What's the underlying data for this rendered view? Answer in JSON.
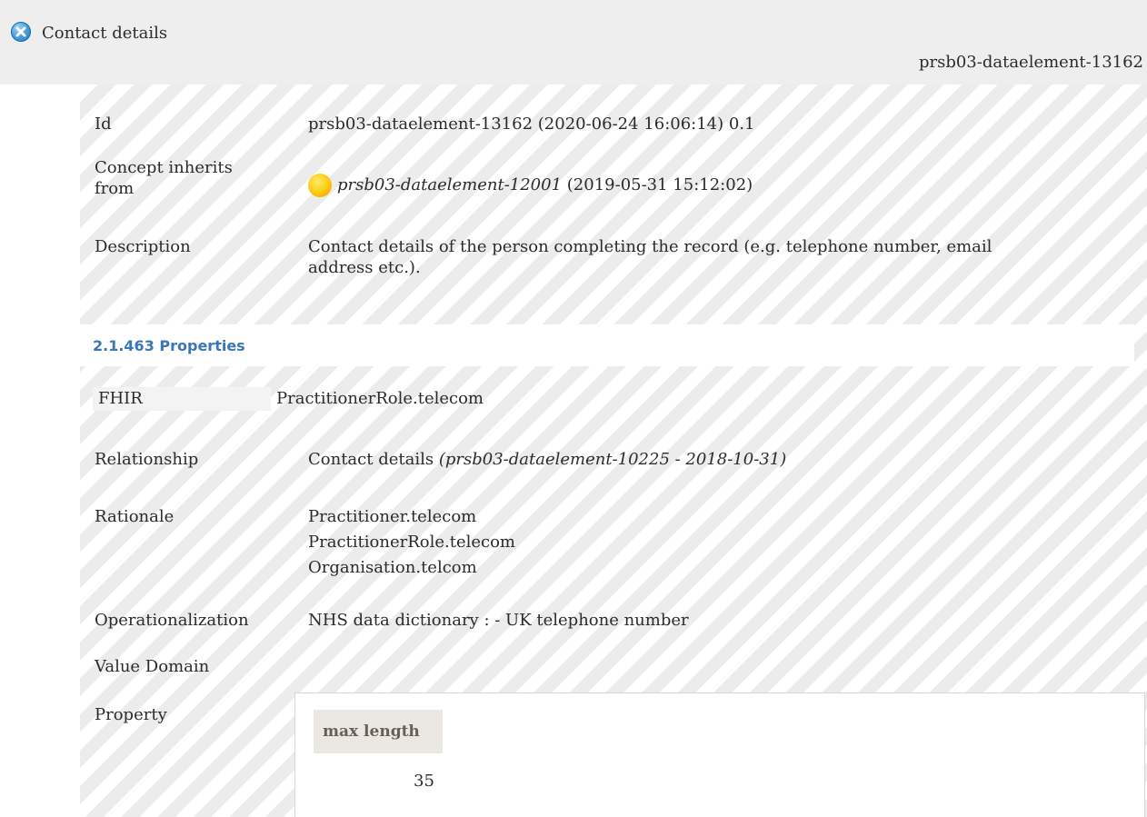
{
  "header": {
    "title": "Contact details",
    "id": "prsb03-dataelement-13162"
  },
  "details": {
    "id_label": "Id",
    "id_value": "prsb03-dataelement-13162 (2020-06-24 16:06:14) 0.1",
    "inherits_label_line1": "Concept inherits",
    "inherits_label_line2": "from",
    "inherits_link": "prsb03-dataelement-12001",
    "inherits_date": "(2019-05-31 15:12:02)",
    "description_label": "Description",
    "description_line1": "Contact details of the person completing the record (e.g. telephone number, email",
    "description_line2": "address etc.)."
  },
  "properties_section": {
    "heading": "2.1.463 Properties",
    "fhir_label": "FHIR",
    "fhir_value": "PractitionerRole.telecom",
    "relationship_label": "Relationship",
    "relationship_value": "Contact details",
    "relationship_ref": "(prsb03-dataelement-10225 - 2018-10-31)",
    "rationale_label": "Rationale",
    "rationale_lines": [
      "Practitioner.telecom",
      "PractitionerRole.telecom",
      "Organisation.telcom"
    ],
    "operationalization_label": "Operationalization",
    "operationalization_value": "NHS data dictionary : - UK telephone number",
    "value_domain_label": "Value Domain",
    "property_label": "Property",
    "property_table": {
      "header": "max length",
      "value": "35"
    }
  },
  "icons": {
    "close": "close-circle-icon",
    "status": "status-yellow-circle-icon"
  },
  "colors": {
    "heading_blue": "#3a78b5",
    "stripe": "#ececec",
    "header_bg": "#eeeeee"
  }
}
